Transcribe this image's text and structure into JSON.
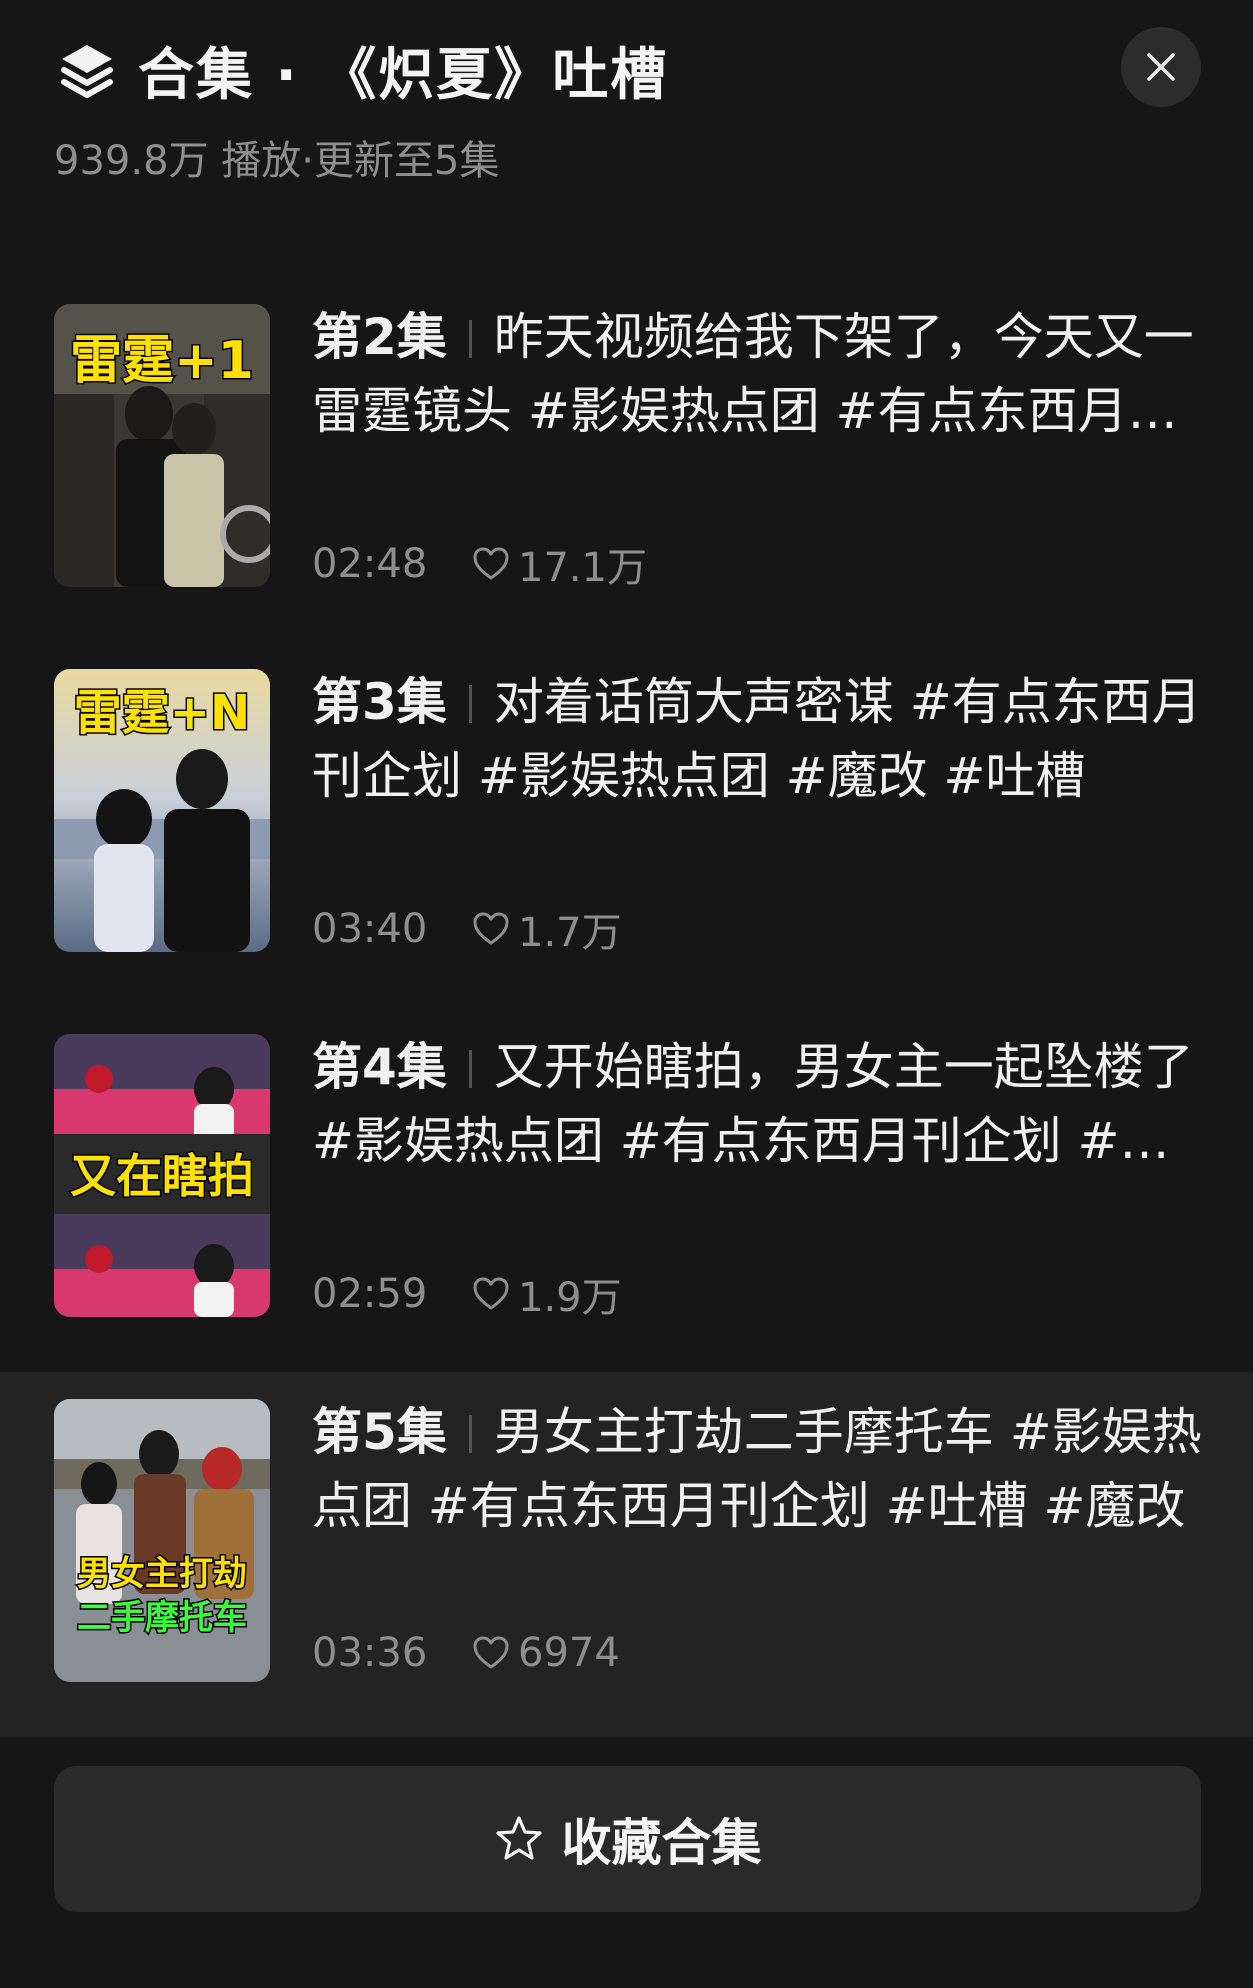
{
  "header": {
    "title": "合集 · 《炽夏》吐槽",
    "subtitle": "939.8万 播放·更新至5集"
  },
  "episodes": [
    {
      "number": "第2集",
      "title": "昨天视频给我下架了，今天又一雷霆镜头 #影娱热点团 #有点东西月刊企划",
      "duration": "02:48",
      "likes": "17.1万",
      "thumb_text": "雷霆+1"
    },
    {
      "number": "第3集",
      "title": "对着话筒大声密谋 #有点东西月刊企划 #影娱热点团 #魔改 #吐槽",
      "duration": "03:40",
      "likes": "1.7万",
      "thumb_text": "雷霆+N"
    },
    {
      "number": "第4集",
      "title": "又开始瞎拍，男女主一起坠楼了 #影娱热点团 #有点东西月刊企划 #吐槽",
      "duration": "02:59",
      "likes": "1.9万",
      "thumb_text": "又在瞎拍"
    },
    {
      "number": "第5集",
      "title": "男女主打劫二手摩托车 #影娱热点团 #有点东西月刊企划 #吐槽 #魔改",
      "duration": "03:36",
      "likes": "6974",
      "thumb_text_line1": "男女主打劫",
      "thumb_text_line2": "二手摩托车"
    }
  ],
  "footer": {
    "collect_label": "收藏合集"
  },
  "icons": {
    "header": "layers-icon",
    "close": "close-icon",
    "likes": "heart-icon",
    "collect": "star-icon"
  },
  "colors": {
    "background": "#161616",
    "active_row": "#232323",
    "muted_text": "#8e8e8e",
    "thumb_yellow": "#ffe100",
    "thumb_green": "#3cff3c"
  }
}
